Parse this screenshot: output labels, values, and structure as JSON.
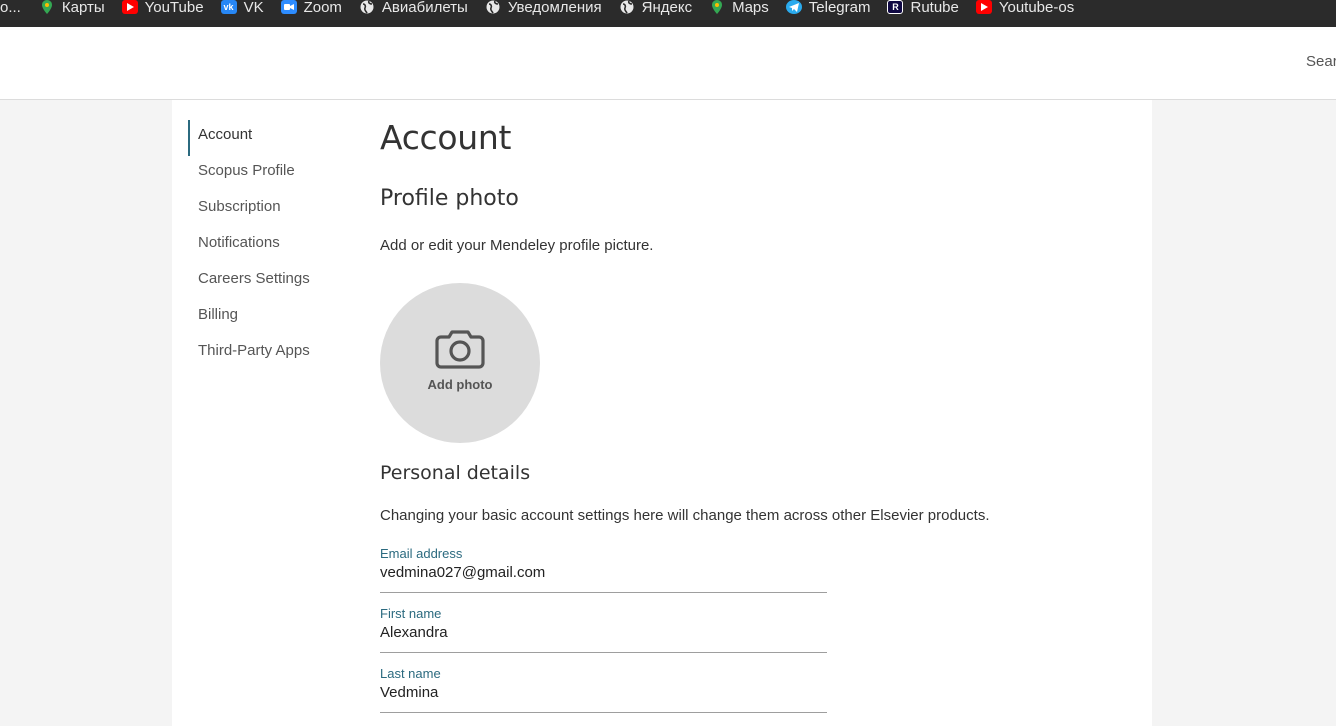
{
  "bookmarks": [
    {
      "label": "о...",
      "icon": "",
      "color": ""
    },
    {
      "label": "Карты",
      "icon": "maps-pin-icon",
      "color": "#34a853"
    },
    {
      "label": "YouTube",
      "icon": "youtube-icon",
      "color": "#ff0000"
    },
    {
      "label": "VK",
      "icon": "vk-icon",
      "color": "#2787f5"
    },
    {
      "label": "Zoom",
      "icon": "zoom-icon",
      "color": "#2d8cff"
    },
    {
      "label": "Авиабилеты",
      "icon": "globe-icon",
      "color": "#ffffff"
    },
    {
      "label": "Уведомления",
      "icon": "globe-icon",
      "color": "#ffffff"
    },
    {
      "label": "Яндекс",
      "icon": "globe-icon",
      "color": "#ffffff"
    },
    {
      "label": "Maps",
      "icon": "maps-pin-icon",
      "color": "#34a853"
    },
    {
      "label": "Telegram",
      "icon": "telegram-icon",
      "color": "#2aabee"
    },
    {
      "label": "Rutube",
      "icon": "rutube-icon",
      "color": "#100943"
    },
    {
      "label": "Youtube-os",
      "icon": "youtube-icon",
      "color": "#ff0000"
    }
  ],
  "header": {
    "search_label": "Searc"
  },
  "sidebar": {
    "items": [
      {
        "label": "Account",
        "active": true
      },
      {
        "label": "Scopus Profile"
      },
      {
        "label": "Subscription"
      },
      {
        "label": "Notifications"
      },
      {
        "label": "Careers Settings"
      },
      {
        "label": "Billing"
      },
      {
        "label": "Third-Party Apps"
      }
    ]
  },
  "main": {
    "title": "Account",
    "profile_photo": {
      "heading": "Profile photo",
      "description": "Add or edit your Mendeley profile picture.",
      "add_label": "Add photo"
    },
    "personal": {
      "heading": "Personal details",
      "description": "Changing your basic account settings here will change them across other Elsevier products.",
      "fields": [
        {
          "label": "Email address",
          "value": "vedmina027@gmail.com"
        },
        {
          "label": "First name",
          "value": "Alexandra"
        },
        {
          "label": "Last name",
          "value": "Vedmina"
        }
      ]
    }
  },
  "colors": {
    "accent": "#2b6a7f",
    "photo_bg": "#dcdcdc",
    "page_bg": "#f4f4f4"
  }
}
